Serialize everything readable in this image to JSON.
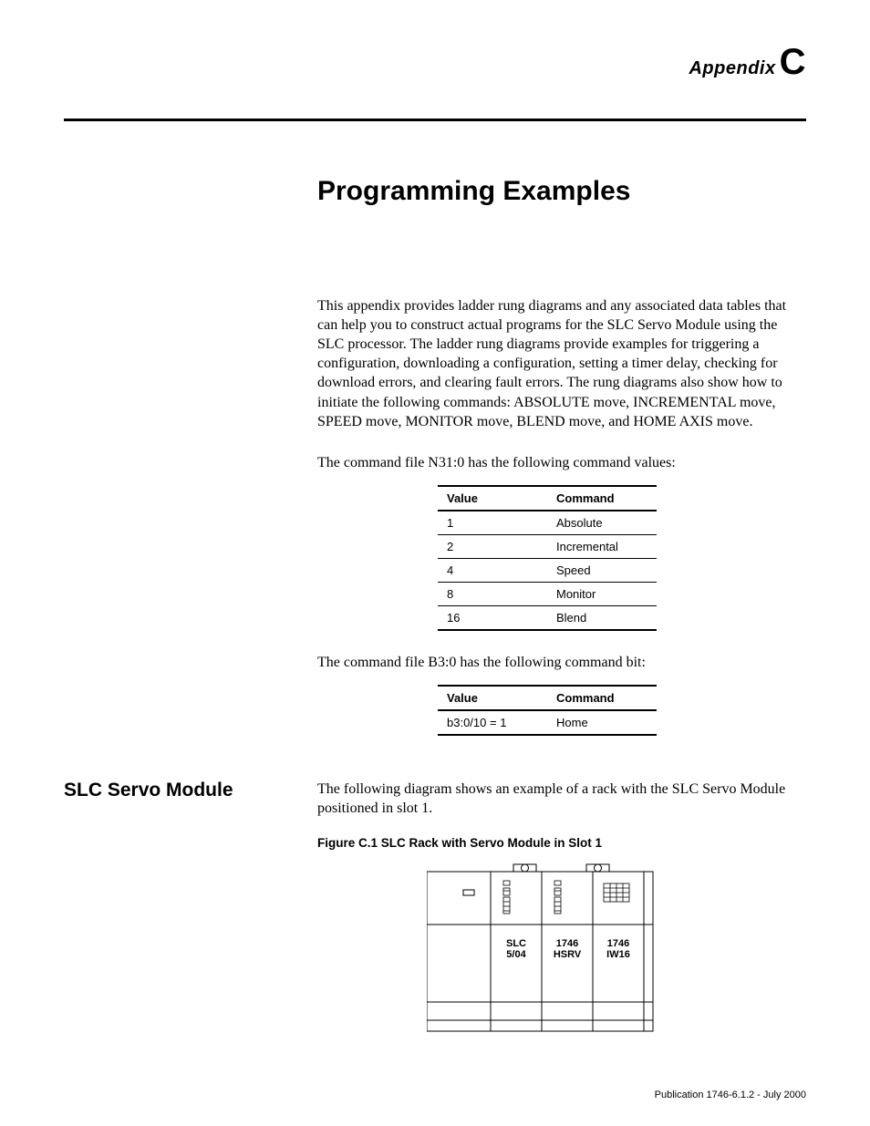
{
  "header": {
    "appendix_word": "Appendix",
    "appendix_letter": "C"
  },
  "title": "Programming Examples",
  "intro_paragraph": "This appendix provides ladder rung diagrams and any associated data tables that can help you to construct actual programs for the SLC Servo Module using the SLC processor.  The ladder rung diagrams provide examples for triggering a configuration, downloading a configuration, setting a timer delay, checking for download errors, and clearing fault errors.  The rung diagrams  also show how to initiate the following commands: ABSOLUTE move,  INCREMENTAL move, SPEED move, MONITOR move, BLEND move, and HOME AXIS move.",
  "n31_sentence": "The command file N31:0 has the following command values:",
  "table_n31": {
    "headers": {
      "value": "Value",
      "command": "Command"
    },
    "rows": [
      {
        "value": "1",
        "command": "Absolute"
      },
      {
        "value": "2",
        "command": "Incremental"
      },
      {
        "value": "4",
        "command": "Speed"
      },
      {
        "value": "8",
        "command": "Monitor"
      },
      {
        "value": "16",
        "command": "Blend"
      }
    ]
  },
  "b3_sentence": "The command file B3:0 has the following command bit:",
  "table_b3": {
    "headers": {
      "value": "Value",
      "command": "Command"
    },
    "rows": [
      {
        "value": "b3:0/10 = 1",
        "command": "Home"
      }
    ]
  },
  "section": {
    "heading": "SLC Servo Module",
    "body": "The following diagram shows an example of a rack with the SLC Servo Module positioned in slot 1."
  },
  "figure": {
    "caption": "Figure C.1 SLC Rack with Servo Module in Slot 1",
    "slots": {
      "slot0_top": "SLC",
      "slot0_bottom": "5/04",
      "slot1_top": "1746",
      "slot1_bottom": "HSRV",
      "slot2_top": "1746",
      "slot2_bottom": "IW16"
    }
  },
  "footer": "Publication 1746-6.1.2 - July 2000"
}
